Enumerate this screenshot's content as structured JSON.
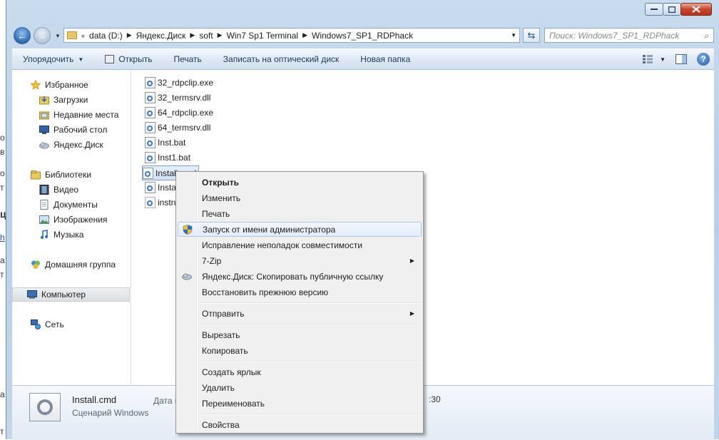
{
  "window": {
    "colors": {
      "accent": "#2c68b0",
      "selection": "#cfe2f7",
      "menu_bg": "#f0f0f0"
    }
  },
  "address": {
    "prefix": "«",
    "crumbs": [
      "data (D:)",
      "Яндекс.Диск",
      "soft",
      "Win7 Sp1 Terminal",
      "Windows7_SP1_RDPhack"
    ]
  },
  "search": {
    "placeholder": "Поиск: Windows7_SP1_RDPhack"
  },
  "toolbar": {
    "organize": "Упорядочить",
    "open": "Открыть",
    "print": "Печать",
    "burn": "Записать на оптический диск",
    "new_folder": "Новая папка",
    "help": "?"
  },
  "nav": {
    "favorites": "Избранное",
    "downloads": "Загрузки",
    "recent": "Недавние места",
    "desktop": "Рабочий стол",
    "yadisk": "Яндекс.Диск",
    "libraries": "Библиотеки",
    "video": "Видео",
    "documents": "Документы",
    "images": "Изображения",
    "music": "Музыка",
    "homegroup": "Домашняя группа",
    "computer": "Компьютер",
    "network": "Сеть"
  },
  "files": [
    "32_rdpclip.exe",
    "32_termsrv.dll",
    "64_rdpclip.exe",
    "64_termsrv.dll",
    "Inst.bat",
    "Inst1.bat",
    "Install.cmd",
    "Install1",
    "instruc"
  ],
  "details": {
    "name": "Install.cmd",
    "type": "Сценарий Windows",
    "date_label": "Дата из",
    "time_fragment": ":30"
  },
  "context_menu": {
    "open": "Открыть",
    "edit": "Изменить",
    "print": "Печать",
    "run_as_admin": "Запуск от имени администратора",
    "troubleshoot": "Исправление неполадок совместимости",
    "sevenzip": "7-Zip",
    "yadisk_copy": "Яндекс.Диск: Скопировать публичную ссылку",
    "restore": "Восстановить прежнюю версию",
    "send_to": "Отправить",
    "cut": "Вырезать",
    "copy": "Копировать",
    "shortcut": "Создать ярлык",
    "delete": "Удалить",
    "rename": "Переименовать",
    "properties": "Свойства"
  },
  "icons": {
    "back": "back-arrow-icon",
    "forward": "forward-arrow-icon",
    "refresh": "refresh-icon",
    "search": "search-icon",
    "shield": "uac-shield-icon",
    "cloud": "yandex-cloud-icon"
  }
}
